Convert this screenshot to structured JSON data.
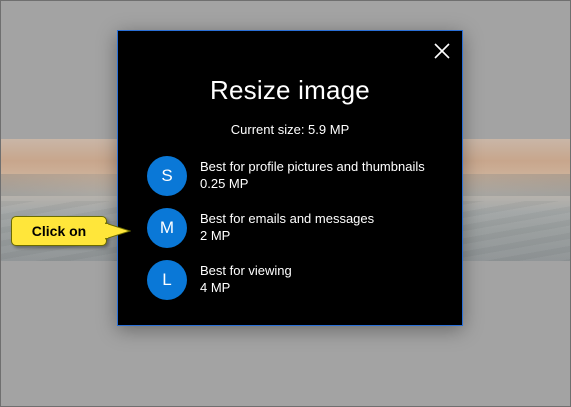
{
  "dialog": {
    "title": "Resize image",
    "current_size": "Current size: 5.9 MP",
    "close_icon": "close-icon",
    "options": [
      {
        "letter": "S",
        "description": "Best for profile pictures and thumbnails",
        "size": "0.25 MP"
      },
      {
        "letter": "M",
        "description": "Best for emails and messages",
        "size": "2 MP"
      },
      {
        "letter": "L",
        "description": "Best for viewing",
        "size": "4 MP"
      }
    ]
  },
  "callout": {
    "text": "Click on"
  },
  "colors": {
    "accent": "#0a78d7",
    "dialog_bg": "#000000",
    "dialog_border": "#2a6fd6",
    "callout_bg": "#ffe63a",
    "backdrop": "#a3a3a3"
  }
}
